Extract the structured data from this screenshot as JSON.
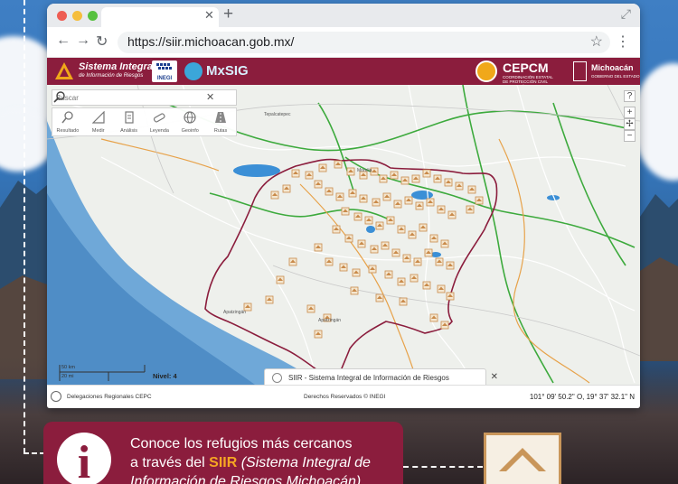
{
  "browser": {
    "url": "https://siir.michoacan.gob.mx/",
    "colors": {
      "close": "#ee5d53",
      "minimize": "#f5be3d",
      "maximize": "#56c13f"
    }
  },
  "header": {
    "siir_title": "Sistema Integral",
    "siir_subtitle": "de Información de Riesgos",
    "inegi": "INEGI",
    "mxsig": "MxSIG",
    "cepcm": "CEPCM",
    "cepcm_subtitle": "COORDINACIÓN ESTATAL DE PROTECCIÓN CIVIL MICHOACÁN",
    "michoacan": "Michoacán",
    "michoacan_subtitle": "GOBIERNO DEL ESTADO",
    "brand_color": "#8b1d3d"
  },
  "map": {
    "search_placeholder": "Buscar",
    "tools": [
      {
        "label": "Resultado",
        "icon": "magnifier-icon"
      },
      {
        "label": "Medir",
        "icon": "ruler-icon"
      },
      {
        "label": "Análisis",
        "icon": "analysis-icon"
      },
      {
        "label": "Leyenda",
        "icon": "legend-icon"
      },
      {
        "label": "Geoinfo",
        "icon": "globe-icon"
      },
      {
        "label": "Rutas",
        "icon": "road-icon"
      }
    ],
    "controls": {
      "help": "?",
      "zoom_in": "+",
      "locate": "✢",
      "zoom_out": "−"
    },
    "place_labels": [
      "Tepalcatepec",
      "Apatzingán",
      "Morelia",
      "Apatzingán"
    ],
    "scale_km": "50 km",
    "scale_mi": "20 mi",
    "level": "Nivel: 4",
    "info_tab": "SIIR - Sistema Integral de Información de Riesgos",
    "colors": {
      "boundary": "#8b1d3d",
      "road_green": "#3daa3d",
      "water": "#3b8fd6",
      "marker": "#d8a060"
    }
  },
  "status": {
    "left": "Delegaciones Regionales CEPC",
    "middle": "Derechos Reservados © INEGI",
    "coords": "101° 09' 50.2\" O, 19° 37' 32.1\" N"
  },
  "banner": {
    "line1": "Conoce los refugios más cercanos",
    "line2_pre": "a través del ",
    "line2_hl": "SIIR",
    "line2_post": " (Sistema Integral de",
    "line3": "Información de Riesgos Michoacán)",
    "highlight_color": "#f5a623"
  }
}
